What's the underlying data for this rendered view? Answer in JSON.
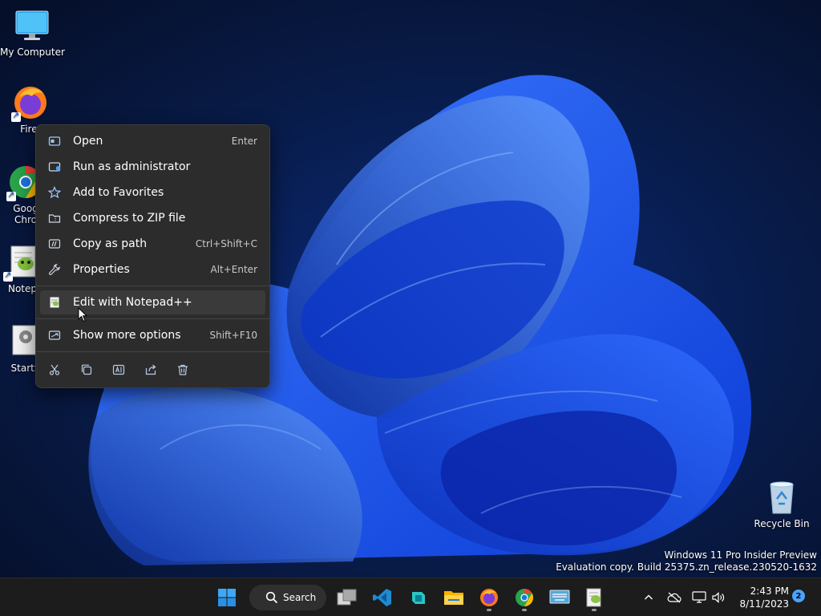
{
  "desktop": {
    "icons": [
      {
        "label": "My Computer",
        "icon": "monitor-icon"
      },
      {
        "label": "Firef",
        "icon": "firefox-icon"
      },
      {
        "label": "Goog\nChro",
        "icon": "chrome-icon"
      },
      {
        "label": "Notep",
        "icon": "notepadpp-icon"
      },
      {
        "label": "StartS",
        "icon": "settings-app-icon"
      },
      {
        "label": "Recycle Bin",
        "icon": "recycle-bin-icon"
      }
    ]
  },
  "context_menu": {
    "items": [
      {
        "label": "Open",
        "shortcut": "Enter",
        "icon": "open-icon"
      },
      {
        "label": "Run as administrator",
        "shortcut": "",
        "icon": "shield-admin-icon"
      },
      {
        "label": "Add to Favorites",
        "shortcut": "",
        "icon": "star-icon"
      },
      {
        "label": "Compress to ZIP file",
        "shortcut": "",
        "icon": "zip-icon"
      },
      {
        "label": "Copy as path",
        "shortcut": "Ctrl+Shift+C",
        "icon": "copy-path-icon"
      },
      {
        "label": "Properties",
        "shortcut": "Alt+Enter",
        "icon": "wrench-icon"
      },
      {
        "label": "Edit with Notepad++",
        "shortcut": "",
        "icon": "notepadpp-icon"
      },
      {
        "label": "Show more options",
        "shortcut": "Shift+F10",
        "icon": "more-options-icon"
      }
    ],
    "hovered_item": "Edit with Notepad++",
    "quick_actions": [
      "cut-icon",
      "copy-icon",
      "rename-icon",
      "share-icon",
      "delete-icon"
    ]
  },
  "watermark": {
    "line1": "Windows 11 Pro Insider Preview",
    "line2": "Evaluation copy. Build 25375.zn_release.230520-1632"
  },
  "taskbar": {
    "search_label": "Search",
    "apps": [
      "start-icon",
      "task-view-icon",
      "vscode-icon",
      "app-icon",
      "file-explorer-icon",
      "firefox-icon",
      "chrome-icon",
      "touch-keyboard-icon",
      "notepadpp-icon"
    ],
    "clock_time": "2:43 PM",
    "clock_date": "8/11/2023",
    "notification_count": "2"
  },
  "colors": {
    "menu_bg": "#2c2c2c",
    "taskbar_bg": "#1c1c1c",
    "accent": "#0078d4"
  }
}
